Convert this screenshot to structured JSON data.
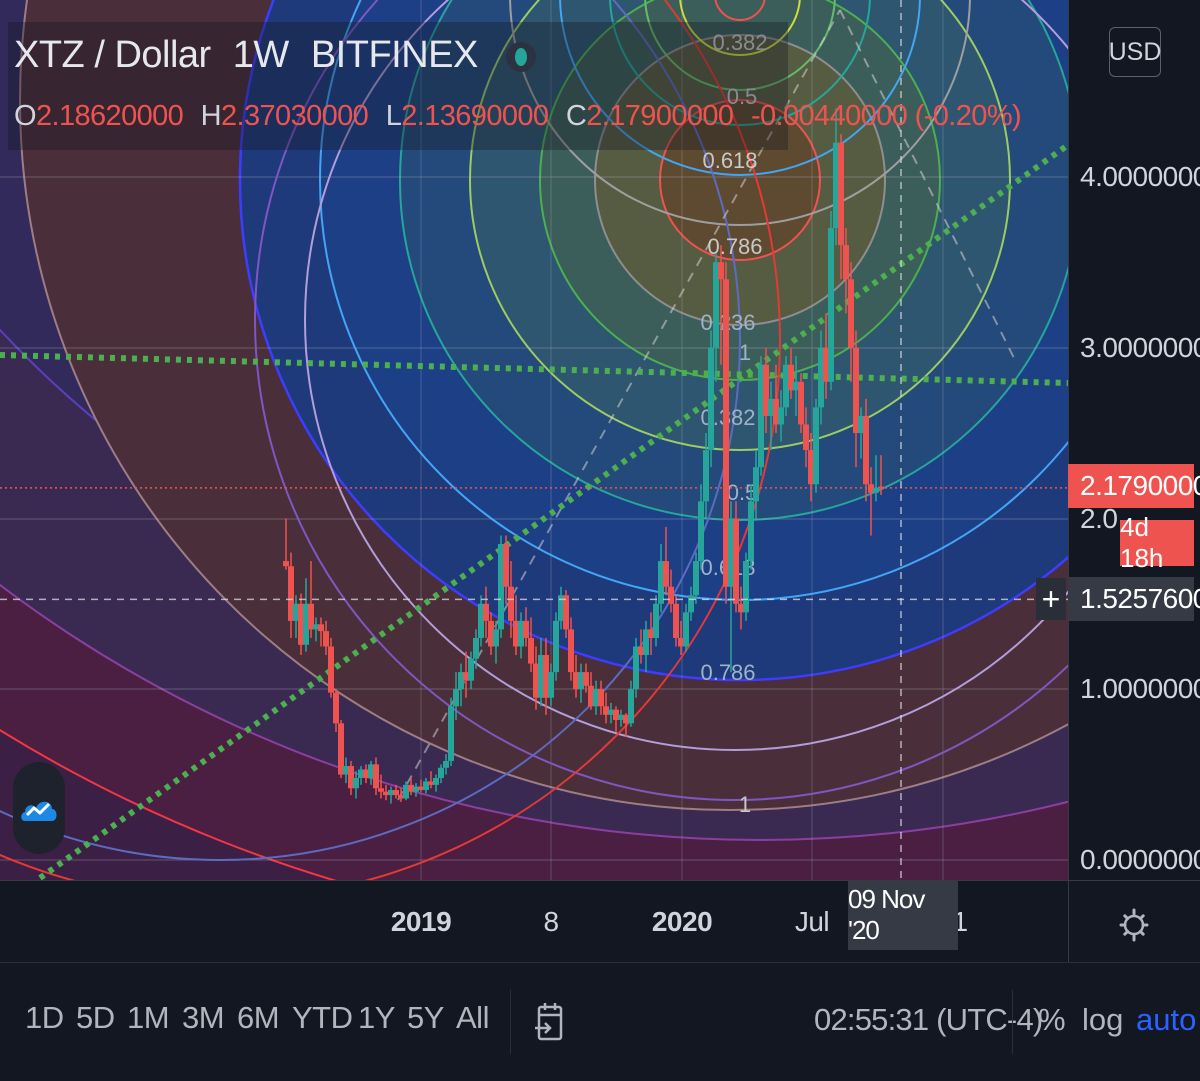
{
  "header": {
    "symbol": "XTZ / Dollar",
    "interval": "1W",
    "exchange": "BITFINEX",
    "currency": "USD"
  },
  "ohlc": {
    "o_label": "O",
    "o": "2.18620000",
    "h_label": "H",
    "h": "2.37030000",
    "l_label": "L",
    "l": "2.13690000",
    "c_label": "C",
    "c": "2.17900000",
    "change": "-0.00440000 (-0.20%)"
  },
  "price_scale": {
    "labels": [
      "4.00000000",
      "3.00000000",
      "1.00000000",
      "0.00000000"
    ],
    "last_price": "2.17900000",
    "countdown": "4d 18h",
    "crosshair_price": "1.52576000",
    "hidden_label": "2.0"
  },
  "time_scale": {
    "labels": [
      "2019",
      "8",
      "2020",
      "Jul",
      "1"
    ],
    "crosshair_date": "09 Nov '20"
  },
  "range_bar": {
    "ranges": [
      "1D",
      "5D",
      "1M",
      "3M",
      "6M",
      "YTD",
      "1Y",
      "5Y",
      "All"
    ],
    "clock": "02:55:31 (UTC-4)",
    "percent": "%",
    "log": "log",
    "auto": "auto"
  },
  "colors": {
    "background": "#131722",
    "up": "#26a69a",
    "down": "#ef5350",
    "fib_levels": [
      "#787b86",
      "#f23645",
      "#81c784",
      "#4caf50",
      "#089981",
      "#64b5f6",
      "#a5d6a7",
      "#2962ff",
      "#9c27b0"
    ],
    "trend": "#4caf50",
    "active": "#2962ff"
  },
  "icons": [
    "status-dot-icon",
    "plus-icon",
    "gear-icon",
    "tradingview-logo-icon",
    "goto-date-icon"
  ],
  "chart_data": {
    "type": "candlestick",
    "symbol": "XTZ / Dollar",
    "timeframe": "1W",
    "ylim": [
      0,
      4.2
    ],
    "xlim": [
      "2018-05-07",
      "2021-02-15"
    ],
    "annotations": {
      "fib_circles_a": [
        "0.382",
        "0.5",
        "0.618",
        "0.786",
        "1"
      ],
      "fib_circles_b": [
        "0.236",
        "0.382",
        "0.5",
        "0.618",
        "0.786",
        "1"
      ],
      "horizontal_levels": [
        3.0,
        2.0
      ],
      "last_price": 2.179,
      "crosshair": {
        "price": 1.52576,
        "date": "2020-11-09"
      }
    },
    "candles": [
      {
        "t": "2018-07-02",
        "o": 1.75,
        "h": 2.0,
        "l": 1.7,
        "c": 1.72
      },
      {
        "t": "2018-07-09",
        "o": 1.72,
        "h": 1.8,
        "l": 1.3,
        "c": 1.4
      },
      {
        "t": "2018-07-16",
        "o": 1.4,
        "h": 1.55,
        "l": 1.3,
        "c": 1.5
      },
      {
        "t": "2018-07-23",
        "o": 1.5,
        "h": 1.56,
        "l": 1.2,
        "c": 1.26
      },
      {
        "t": "2018-07-30",
        "o": 1.26,
        "h": 1.65,
        "l": 1.22,
        "c": 1.5
      },
      {
        "t": "2018-08-06",
        "o": 1.5,
        "h": 1.75,
        "l": 1.3,
        "c": 1.35
      },
      {
        "t": "2018-08-13",
        "o": 1.35,
        "h": 1.42,
        "l": 1.28,
        "c": 1.38
      },
      {
        "t": "2018-08-20",
        "o": 1.38,
        "h": 1.42,
        "l": 1.25,
        "c": 1.34
      },
      {
        "t": "2018-08-27",
        "o": 1.34,
        "h": 1.4,
        "l": 1.2,
        "c": 1.25
      },
      {
        "t": "2018-09-03",
        "o": 1.25,
        "h": 1.3,
        "l": 0.95,
        "c": 0.98
      },
      {
        "t": "2018-09-10",
        "o": 0.98,
        "h": 1.0,
        "l": 0.75,
        "c": 0.8
      },
      {
        "t": "2018-09-17",
        "o": 0.8,
        "h": 0.82,
        "l": 0.48,
        "c": 0.5
      },
      {
        "t": "2018-09-24",
        "o": 0.5,
        "h": 0.6,
        "l": 0.45,
        "c": 0.55
      },
      {
        "t": "2018-10-01",
        "o": 0.55,
        "h": 0.58,
        "l": 0.38,
        "c": 0.42
      },
      {
        "t": "2018-10-08",
        "o": 0.42,
        "h": 0.52,
        "l": 0.36,
        "c": 0.48
      },
      {
        "t": "2018-10-15",
        "o": 0.48,
        "h": 0.55,
        "l": 0.44,
        "c": 0.53
      },
      {
        "t": "2018-10-22",
        "o": 0.53,
        "h": 0.56,
        "l": 0.45,
        "c": 0.48
      },
      {
        "t": "2018-10-29",
        "o": 0.48,
        "h": 0.58,
        "l": 0.44,
        "c": 0.56
      },
      {
        "t": "2018-11-05",
        "o": 0.56,
        "h": 0.6,
        "l": 0.38,
        "c": 0.42
      },
      {
        "t": "2018-11-12",
        "o": 0.42,
        "h": 0.5,
        "l": 0.36,
        "c": 0.4
      },
      {
        "t": "2018-11-19",
        "o": 0.4,
        "h": 0.44,
        "l": 0.35,
        "c": 0.38
      },
      {
        "t": "2018-11-26",
        "o": 0.38,
        "h": 0.43,
        "l": 0.33,
        "c": 0.41
      },
      {
        "t": "2018-12-03",
        "o": 0.41,
        "h": 0.44,
        "l": 0.36,
        "c": 0.38
      },
      {
        "t": "2018-12-10",
        "o": 0.38,
        "h": 0.42,
        "l": 0.34,
        "c": 0.36
      },
      {
        "t": "2018-12-17",
        "o": 0.36,
        "h": 0.46,
        "l": 0.35,
        "c": 0.44
      },
      {
        "t": "2018-12-24",
        "o": 0.44,
        "h": 0.48,
        "l": 0.38,
        "c": 0.4
      },
      {
        "t": "2018-12-31",
        "o": 0.4,
        "h": 0.45,
        "l": 0.37,
        "c": 0.43
      },
      {
        "t": "2019-01-07",
        "o": 0.43,
        "h": 0.47,
        "l": 0.4,
        "c": 0.41
      },
      {
        "t": "2019-01-14",
        "o": 0.41,
        "h": 0.48,
        "l": 0.39,
        "c": 0.46
      },
      {
        "t": "2019-01-21",
        "o": 0.46,
        "h": 0.52,
        "l": 0.42,
        "c": 0.44
      },
      {
        "t": "2019-01-28",
        "o": 0.44,
        "h": 0.5,
        "l": 0.4,
        "c": 0.48
      },
      {
        "t": "2019-02-04",
        "o": 0.48,
        "h": 0.56,
        "l": 0.45,
        "c": 0.54
      },
      {
        "t": "2019-02-11",
        "o": 0.54,
        "h": 0.62,
        "l": 0.5,
        "c": 0.58
      },
      {
        "t": "2019-02-18",
        "o": 0.58,
        "h": 0.95,
        "l": 0.55,
        "c": 0.9
      },
      {
        "t": "2019-02-25",
        "o": 0.9,
        "h": 1.1,
        "l": 0.82,
        "c": 1.0
      },
      {
        "t": "2019-03-04",
        "o": 1.0,
        "h": 1.15,
        "l": 0.9,
        "c": 1.1
      },
      {
        "t": "2019-03-11",
        "o": 1.1,
        "h": 1.22,
        "l": 0.95,
        "c": 1.05
      },
      {
        "t": "2019-03-18",
        "o": 1.05,
        "h": 1.22,
        "l": 1.0,
        "c": 1.18
      },
      {
        "t": "2019-03-25",
        "o": 1.18,
        "h": 1.35,
        "l": 1.12,
        "c": 1.3
      },
      {
        "t": "2019-04-01",
        "o": 1.3,
        "h": 1.55,
        "l": 1.25,
        "c": 1.5
      },
      {
        "t": "2019-04-08",
        "o": 1.5,
        "h": 1.6,
        "l": 1.3,
        "c": 1.4
      },
      {
        "t": "2019-04-15",
        "o": 1.4,
        "h": 1.45,
        "l": 1.2,
        "c": 1.25
      },
      {
        "t": "2019-04-22",
        "o": 1.25,
        "h": 1.4,
        "l": 1.15,
        "c": 1.35
      },
      {
        "t": "2019-04-29",
        "o": 1.35,
        "h": 1.9,
        "l": 1.3,
        "c": 1.85
      },
      {
        "t": "2019-05-06",
        "o": 1.85,
        "h": 1.9,
        "l": 1.5,
        "c": 1.6
      },
      {
        "t": "2019-05-13",
        "o": 1.6,
        "h": 1.75,
        "l": 1.3,
        "c": 1.4
      },
      {
        "t": "2019-05-20",
        "o": 1.4,
        "h": 1.55,
        "l": 1.2,
        "c": 1.25
      },
      {
        "t": "2019-05-27",
        "o": 1.25,
        "h": 1.45,
        "l": 1.18,
        "c": 1.4
      },
      {
        "t": "2019-06-03",
        "o": 1.4,
        "h": 1.48,
        "l": 1.25,
        "c": 1.3
      },
      {
        "t": "2019-06-10",
        "o": 1.3,
        "h": 1.42,
        "l": 1.1,
        "c": 1.15
      },
      {
        "t": "2019-06-17",
        "o": 1.15,
        "h": 1.25,
        "l": 0.88,
        "c": 0.95
      },
      {
        "t": "2019-06-24",
        "o": 0.95,
        "h": 1.3,
        "l": 0.9,
        "c": 1.2
      },
      {
        "t": "2019-07-01",
        "o": 1.2,
        "h": 1.3,
        "l": 0.85,
        "c": 0.95
      },
      {
        "t": "2019-07-08",
        "o": 0.95,
        "h": 1.15,
        "l": 0.9,
        "c": 1.1
      },
      {
        "t": "2019-07-15",
        "o": 1.1,
        "h": 1.45,
        "l": 1.05,
        "c": 1.4
      },
      {
        "t": "2019-07-22",
        "o": 1.4,
        "h": 1.6,
        "l": 1.35,
        "c": 1.55
      },
      {
        "t": "2019-07-29",
        "o": 1.55,
        "h": 1.58,
        "l": 1.3,
        "c": 1.35
      },
      {
        "t": "2019-08-05",
        "o": 1.35,
        "h": 1.42,
        "l": 1.05,
        "c": 1.1
      },
      {
        "t": "2019-08-12",
        "o": 1.1,
        "h": 1.2,
        "l": 0.95,
        "c": 1.0
      },
      {
        "t": "2019-08-19",
        "o": 1.0,
        "h": 1.15,
        "l": 0.92,
        "c": 1.1
      },
      {
        "t": "2019-08-26",
        "o": 1.1,
        "h": 1.15,
        "l": 0.98,
        "c": 1.02
      },
      {
        "t": "2019-09-02",
        "o": 1.02,
        "h": 1.1,
        "l": 0.88,
        "c": 0.9
      },
      {
        "t": "2019-09-09",
        "o": 0.9,
        "h": 1.05,
        "l": 0.85,
        "c": 1.0
      },
      {
        "t": "2019-09-16",
        "o": 1.0,
        "h": 1.05,
        "l": 0.85,
        "c": 0.9
      },
      {
        "t": "2019-09-23",
        "o": 0.9,
        "h": 0.98,
        "l": 0.8,
        "c": 0.85
      },
      {
        "t": "2019-09-30",
        "o": 0.85,
        "h": 0.92,
        "l": 0.8,
        "c": 0.88
      },
      {
        "t": "2019-10-07",
        "o": 0.88,
        "h": 0.9,
        "l": 0.75,
        "c": 0.82
      },
      {
        "t": "2019-10-14",
        "o": 0.82,
        "h": 0.88,
        "l": 0.78,
        "c": 0.85
      },
      {
        "t": "2019-10-21",
        "o": 0.85,
        "h": 0.86,
        "l": 0.72,
        "c": 0.8
      },
      {
        "t": "2019-10-28",
        "o": 0.8,
        "h": 1.05,
        "l": 0.78,
        "c": 1.0
      },
      {
        "t": "2019-11-04",
        "o": 1.0,
        "h": 1.3,
        "l": 0.95,
        "c": 1.25
      },
      {
        "t": "2019-11-11",
        "o": 1.25,
        "h": 1.35,
        "l": 1.15,
        "c": 1.2
      },
      {
        "t": "2019-11-18",
        "o": 1.2,
        "h": 1.4,
        "l": 1.1,
        "c": 1.35
      },
      {
        "t": "2019-11-25",
        "o": 1.35,
        "h": 1.45,
        "l": 1.2,
        "c": 1.3
      },
      {
        "t": "2019-12-02",
        "o": 1.3,
        "h": 1.55,
        "l": 1.25,
        "c": 1.5
      },
      {
        "t": "2019-12-09",
        "o": 1.5,
        "h": 1.85,
        "l": 1.45,
        "c": 1.75
      },
      {
        "t": "2019-12-16",
        "o": 1.75,
        "h": 1.95,
        "l": 1.55,
        "c": 1.6
      },
      {
        "t": "2019-12-23",
        "o": 1.6,
        "h": 1.7,
        "l": 1.45,
        "c": 1.5
      },
      {
        "t": "2019-12-30",
        "o": 1.5,
        "h": 1.55,
        "l": 1.25,
        "c": 1.3
      },
      {
        "t": "2020-01-06",
        "o": 1.3,
        "h": 1.4,
        "l": 1.2,
        "c": 1.25
      },
      {
        "t": "2020-01-13",
        "o": 1.25,
        "h": 1.5,
        "l": 1.22,
        "c": 1.45
      },
      {
        "t": "2020-01-20",
        "o": 1.45,
        "h": 1.6,
        "l": 1.4,
        "c": 1.55
      },
      {
        "t": "2020-01-27",
        "o": 1.55,
        "h": 1.8,
        "l": 1.5,
        "c": 1.75
      },
      {
        "t": "2020-02-03",
        "o": 1.75,
        "h": 2.2,
        "l": 1.7,
        "c": 2.1
      },
      {
        "t": "2020-02-10",
        "o": 2.1,
        "h": 2.5,
        "l": 2.0,
        "c": 2.4
      },
      {
        "t": "2020-02-17",
        "o": 2.4,
        "h": 3.1,
        "l": 2.3,
        "c": 3.0
      },
      {
        "t": "2020-02-24",
        "o": 3.0,
        "h": 3.55,
        "l": 2.8,
        "c": 3.5
      },
      {
        "t": "2020-03-02",
        "o": 3.5,
        "h": 3.6,
        "l": 2.9,
        "c": 3.4
      },
      {
        "t": "2020-03-09",
        "o": 3.4,
        "h": 3.5,
        "l": 1.5,
        "c": 1.6
      },
      {
        "t": "2020-03-16",
        "o": 1.6,
        "h": 2.1,
        "l": 1.1,
        "c": 2.0
      },
      {
        "t": "2020-03-23",
        "o": 2.0,
        "h": 2.1,
        "l": 1.45,
        "c": 1.5
      },
      {
        "t": "2020-03-30",
        "o": 1.5,
        "h": 1.6,
        "l": 1.35,
        "c": 1.45
      },
      {
        "t": "2020-04-06",
        "o": 1.45,
        "h": 1.8,
        "l": 1.4,
        "c": 1.75
      },
      {
        "t": "2020-04-13",
        "o": 1.75,
        "h": 2.2,
        "l": 1.7,
        "c": 2.1
      },
      {
        "t": "2020-04-20",
        "o": 2.1,
        "h": 2.4,
        "l": 2.0,
        "c": 2.3
      },
      {
        "t": "2020-04-27",
        "o": 2.3,
        "h": 2.95,
        "l": 2.25,
        "c": 2.9
      },
      {
        "t": "2020-05-04",
        "o": 2.9,
        "h": 3.0,
        "l": 2.5,
        "c": 2.6
      },
      {
        "t": "2020-05-11",
        "o": 2.6,
        "h": 2.8,
        "l": 2.4,
        "c": 2.7
      },
      {
        "t": "2020-05-18",
        "o": 2.7,
        "h": 2.9,
        "l": 2.5,
        "c": 2.55
      },
      {
        "t": "2020-05-25",
        "o": 2.55,
        "h": 2.75,
        "l": 2.45,
        "c": 2.65
      },
      {
        "t": "2020-06-01",
        "o": 2.65,
        "h": 2.95,
        "l": 2.6,
        "c": 2.9
      },
      {
        "t": "2020-06-08",
        "o": 2.9,
        "h": 3.0,
        "l": 2.7,
        "c": 2.75
      },
      {
        "t": "2020-06-15",
        "o": 2.75,
        "h": 2.95,
        "l": 2.6,
        "c": 2.8
      },
      {
        "t": "2020-06-22",
        "o": 2.8,
        "h": 2.85,
        "l": 2.5,
        "c": 2.55
      },
      {
        "t": "2020-06-29",
        "o": 2.55,
        "h": 2.65,
        "l": 2.3,
        "c": 2.4
      },
      {
        "t": "2020-07-06",
        "o": 2.4,
        "h": 2.5,
        "l": 2.1,
        "c": 2.2
      },
      {
        "t": "2020-07-13",
        "o": 2.2,
        "h": 2.7,
        "l": 2.15,
        "c": 2.65
      },
      {
        "t": "2020-07-20",
        "o": 2.65,
        "h": 3.1,
        "l": 2.55,
        "c": 3.0
      },
      {
        "t": "2020-07-27",
        "o": 3.0,
        "h": 3.2,
        "l": 2.7,
        "c": 2.8
      },
      {
        "t": "2020-08-03",
        "o": 2.8,
        "h": 3.8,
        "l": 2.75,
        "c": 3.7
      },
      {
        "t": "2020-08-10",
        "o": 3.7,
        "h": 4.4,
        "l": 3.6,
        "c": 4.2
      },
      {
        "t": "2020-08-17",
        "o": 4.2,
        "h": 4.25,
        "l": 3.4,
        "c": 3.6
      },
      {
        "t": "2020-08-24",
        "o": 3.6,
        "h": 3.7,
        "l": 3.2,
        "c": 3.4
      },
      {
        "t": "2020-08-31",
        "o": 3.4,
        "h": 3.5,
        "l": 2.8,
        "c": 3.0
      },
      {
        "t": "2020-09-07",
        "o": 3.0,
        "h": 3.1,
        "l": 2.3,
        "c": 2.5
      },
      {
        "t": "2020-09-14",
        "o": 2.5,
        "h": 2.65,
        "l": 2.35,
        "c": 2.6
      },
      {
        "t": "2020-09-21",
        "o": 2.6,
        "h": 2.7,
        "l": 2.1,
        "c": 2.2
      },
      {
        "t": "2020-09-28",
        "o": 2.2,
        "h": 2.3,
        "l": 1.9,
        "c": 2.15
      },
      {
        "t": "2020-10-05",
        "o": 2.15,
        "h": 2.37,
        "l": 2.1,
        "c": 2.18
      },
      {
        "t": "2020-10-12",
        "o": 2.1862,
        "h": 2.3703,
        "l": 2.1369,
        "c": 2.179
      }
    ]
  }
}
